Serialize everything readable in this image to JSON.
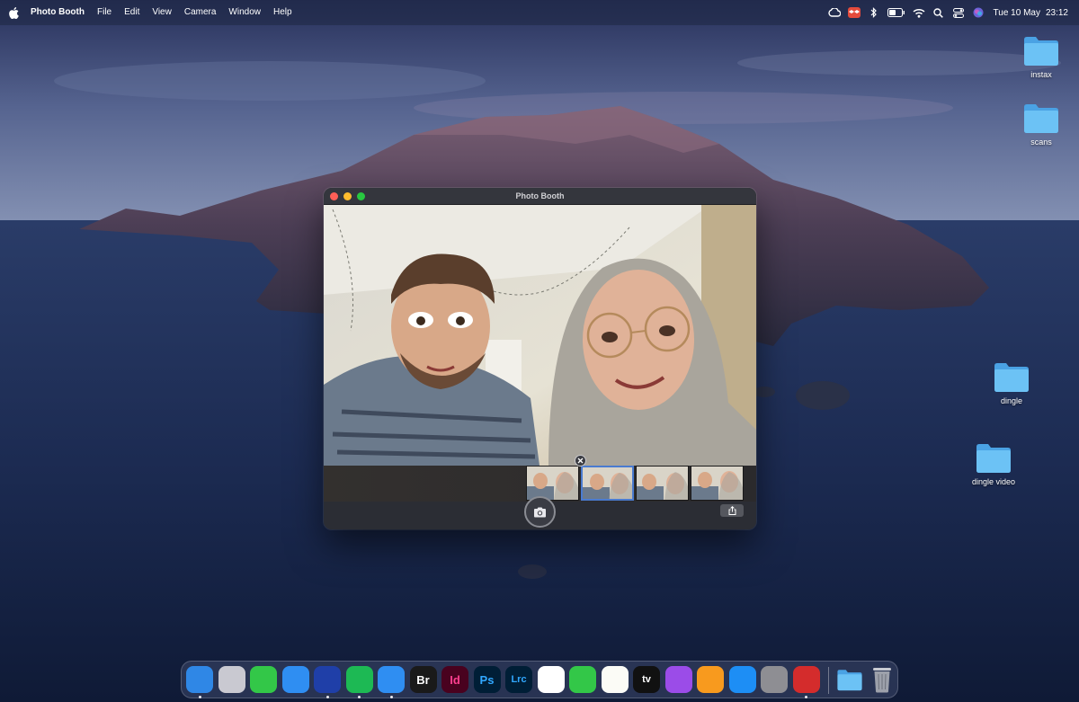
{
  "menubar": {
    "apple_icon": "apple-logo-icon",
    "app_name": "Photo Booth",
    "items": [
      "File",
      "Edit",
      "View",
      "Camera",
      "Window",
      "Help"
    ],
    "status_icons": [
      "creative-cloud-icon",
      "dropbox-icon",
      "bluetooth-icon",
      "battery-icon",
      "wifi-icon",
      "spotlight-search-icon",
      "control-center-icon",
      "siri-icon"
    ],
    "date": "Tue 10 May",
    "time": "23:12"
  },
  "desktop": {
    "folders": [
      {
        "label": "instax"
      },
      {
        "label": "scans"
      },
      {
        "label": "dingle"
      },
      {
        "label": "dingle video"
      }
    ],
    "folder_color": "#5fb8f2"
  },
  "window": {
    "title": "Photo Booth",
    "traffic_lights": {
      "close": "#ff5f57",
      "minimize": "#febc2e",
      "maximize": "#28c840"
    },
    "thumbnail_count": 4,
    "selected_thumbnail": 2,
    "shutter_icon": "camera-icon",
    "share_icon": "share-icon",
    "delete_icon": "close-icon"
  },
  "dock": {
    "apps": [
      {
        "name": "Finder",
        "icon": "finder-icon",
        "text": "",
        "bg": "#2f87e6",
        "running": true
      },
      {
        "name": "Launchpad",
        "icon": "launchpad-icon",
        "text": "",
        "bg": "#c9c9d1",
        "running": false
      },
      {
        "name": "Messages",
        "icon": "messages-icon",
        "text": "",
        "bg": "#33c748",
        "running": false
      },
      {
        "name": "Mail",
        "icon": "mail-icon",
        "text": "",
        "bg": "#2f8ef2",
        "running": false
      },
      {
        "name": "Xcode-like Scanner",
        "icon": "scanner-icon",
        "text": "",
        "bg": "#1f3fa8",
        "running": true
      },
      {
        "name": "Spotify",
        "icon": "spotify-icon",
        "text": "",
        "bg": "#1db954",
        "running": true
      },
      {
        "name": "Safari",
        "icon": "safari-icon",
        "text": "",
        "bg": "#2f8ef2",
        "running": true
      },
      {
        "name": "Bridge",
        "icon": "bridge-icon",
        "text": "Br",
        "bg": "#1a1a1a",
        "running": false
      },
      {
        "name": "InDesign",
        "icon": "indesign-icon",
        "text": "Id",
        "bg": "#49021f",
        "running": false
      },
      {
        "name": "Photoshop",
        "icon": "photoshop-icon",
        "text": "Ps",
        "bg": "#001e36",
        "running": false
      },
      {
        "name": "Lightroom Classic",
        "icon": "lightroom-icon",
        "text": "Lrc",
        "bg": "#001e36",
        "running": false
      },
      {
        "name": "Photos",
        "icon": "photos-icon",
        "text": "",
        "bg": "#ffffff",
        "running": false
      },
      {
        "name": "FaceTime",
        "icon": "facetime-icon",
        "text": "",
        "bg": "#33c748",
        "running": false
      },
      {
        "name": "Notes",
        "icon": "notes-icon",
        "text": "",
        "bg": "#fbfbf6",
        "running": false
      },
      {
        "name": "TV",
        "icon": "apple-tv-icon",
        "text": "tv",
        "bg": "#111111",
        "running": false
      },
      {
        "name": "Podcasts",
        "icon": "podcasts-icon",
        "text": "",
        "bg": "#9b4ce8",
        "running": false
      },
      {
        "name": "Pages",
        "icon": "pages-icon",
        "text": "",
        "bg": "#f89a1e",
        "running": false
      },
      {
        "name": "App Store",
        "icon": "app-store-icon",
        "text": "",
        "bg": "#1d8ef5",
        "running": false
      },
      {
        "name": "System Preferences",
        "icon": "system-preferences-icon",
        "text": "",
        "bg": "#8e8e93",
        "running": false
      },
      {
        "name": "Photo Booth",
        "icon": "photo-booth-icon",
        "text": "",
        "bg": "#d42c2c",
        "running": true
      }
    ],
    "downloads_icon": "folder-icon",
    "trash_icon": "trash-icon"
  }
}
